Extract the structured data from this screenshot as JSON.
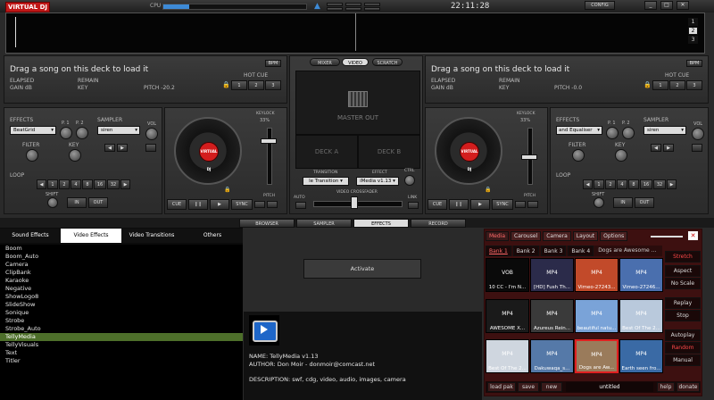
{
  "app": {
    "logo": "VIRTUAL DJ",
    "cpu_label": "CPU",
    "cpu_load": 0.18,
    "clock": "22:11:28",
    "config_label": "CONFIG",
    "win_min": "_",
    "win_max": "□",
    "win_close": "✕"
  },
  "deck_buttons": [
    "1",
    "2",
    "3"
  ],
  "deck_left": {
    "title": "Drag a song on this deck to load it",
    "bpm_btn": "BPM",
    "elapsed": "ELAPSED",
    "remain": "REMAIN",
    "gain": "GAIN dB",
    "key": "KEY",
    "pitch": "PITCH -20.2",
    "hot_cue": "HOT CUE",
    "hot_cue_buttons": [
      "1",
      "2",
      "3"
    ],
    "effects_label": "EFFECTS",
    "effect_value": "BeatGrid",
    "p1": "P. 1",
    "p2": "P. 2",
    "sampler_label": "SAMPLER",
    "sampler_value": "siren",
    "vol": "VOL",
    "filter": "FILTER",
    "key_label": "KEY",
    "loop": "LOOP",
    "loop_buttons": [
      "1",
      "2",
      "4",
      "8",
      "16",
      "32"
    ],
    "shift": "SHIFT",
    "in": "IN",
    "out": "OUT",
    "keylock": "KEYLOCK",
    "keylock_pct": "33%",
    "pitch_label": "PITCH",
    "cue": "CUE",
    "pause": "❙❙",
    "play": "▶",
    "sync": "SYNC"
  },
  "deck_right": {
    "title": "Drag a song on this deck to load it",
    "bpm_btn": "BPM",
    "elapsed": "ELAPSED",
    "remain": "REMAIN",
    "gain": "GAIN dB",
    "key": "KEY",
    "pitch": "PITCH -0.0",
    "hot_cue": "HOT CUE",
    "hot_cue_buttons": [
      "1",
      "2",
      "3"
    ],
    "effects_label": "EFFECTS",
    "effect_value": "and Equaliser",
    "p1": "P. 1",
    "p2": "P. 2",
    "sampler_label": "SAMPLER",
    "sampler_value": "siren",
    "vol": "VOL",
    "filter": "FILTER",
    "key_label": "KEY",
    "loop": "LOOP",
    "loop_buttons": [
      "1",
      "2",
      "4",
      "8",
      "16",
      "32"
    ],
    "shift": "SHIFT",
    "in": "IN",
    "out": "OUT",
    "keylock": "KEYLOCK",
    "keylock_pct": "33%",
    "pitch_label": "PITCH",
    "cue": "CUE",
    "pause": "❙❙",
    "play": "▶",
    "sync": "SYNC"
  },
  "center": {
    "mode_tabs": [
      "MIXER",
      "VIDEO",
      "SCRATCH"
    ],
    "master_out": "MASTER OUT",
    "deck_a": "DECK A",
    "deck_b": "DECK B",
    "transition_label": "TRANSITION",
    "transition_value": "le Transition",
    "effect_label": "EFFECT",
    "effect_value": "iMedia v1.13",
    "ctrl": "CTRL",
    "auto": "AUTO",
    "crossfader": "VIDEO CROSSFADER",
    "link": "LINK"
  },
  "main_tabs": [
    "BROWSER",
    "SAMPLER",
    "EFFECTS",
    "RECORD"
  ],
  "fx_tabs": [
    "Sound Effects",
    "Video Effects",
    "Video Transitions",
    "Others"
  ],
  "fx_list": [
    "Boom",
    "Boom_Auto",
    "Camera",
    "ClipBank",
    "Karaoke",
    "Negative",
    "ShowLogo8",
    "SlideShow",
    "Sonique",
    "Strobe",
    "Strobe_Auto",
    "TellyMedia",
    "TellyVisuals",
    "Text",
    "Titler"
  ],
  "fx_selected": "TellyMedia",
  "activate": "Activate",
  "plugin_info": {
    "name": "NAME: TellyMedia v1.13",
    "author": "AUTHOR: Don Moir - donmoir@comcast.net",
    "description": "DESCRIPTION: swf, cdg, video, audio, images, camera"
  },
  "media": {
    "tabs": [
      "Media",
      "Carousel",
      "Camera",
      "Layout",
      "Options"
    ],
    "banks": [
      "Bank 1",
      "Bank 2",
      "Bank 3",
      "Bank 4"
    ],
    "bank_title": "Dogs are Awesome ...",
    "thumbs": [
      {
        "type": "VOB",
        "title": "10 CC - I'm N...",
        "color": "#0a0a0a"
      },
      {
        "type": "MP4",
        "title": "[HD] Fush Th...",
        "color": "#2b2b4a"
      },
      {
        "type": "MP4",
        "title": "Vimeo-27243...",
        "color": "#c24a2a"
      },
      {
        "type": "MP4",
        "title": "Vimeo-27246...",
        "color": "#4a6fae"
      },
      {
        "type": "MP4",
        "title": "AWESOME X...",
        "color": "#1a1a1a"
      },
      {
        "type": "MP4",
        "title": "Azureus Rein...",
        "color": "#3a3a3a"
      },
      {
        "type": "MP4",
        "title": "beautiful natu...",
        "color": "#7aa3d8"
      },
      {
        "type": "MP4",
        "title": "Best Of The 2...",
        "color": "#b9c9dc"
      },
      {
        "type": "MP4",
        "title": "Best Of The 2...",
        "color": "#cfd6df"
      },
      {
        "type": "MP4",
        "title": "Dakuwaqa_s...",
        "color": "#5579a8"
      },
      {
        "type": "MP4",
        "title": "Dogs are Aw...",
        "color": "#9a7b5b"
      },
      {
        "type": "MP4",
        "title": "Earth seen fro...",
        "color": "#3a6aa5"
      }
    ],
    "side_buttons": [
      "Stretch",
      "Aspect",
      "No Scale",
      "Replay",
      "Stop",
      "Autoplay",
      "Random",
      "Manual"
    ],
    "bottom": [
      "load pak",
      "save",
      "new",
      "untitled",
      "help",
      "donate"
    ]
  }
}
